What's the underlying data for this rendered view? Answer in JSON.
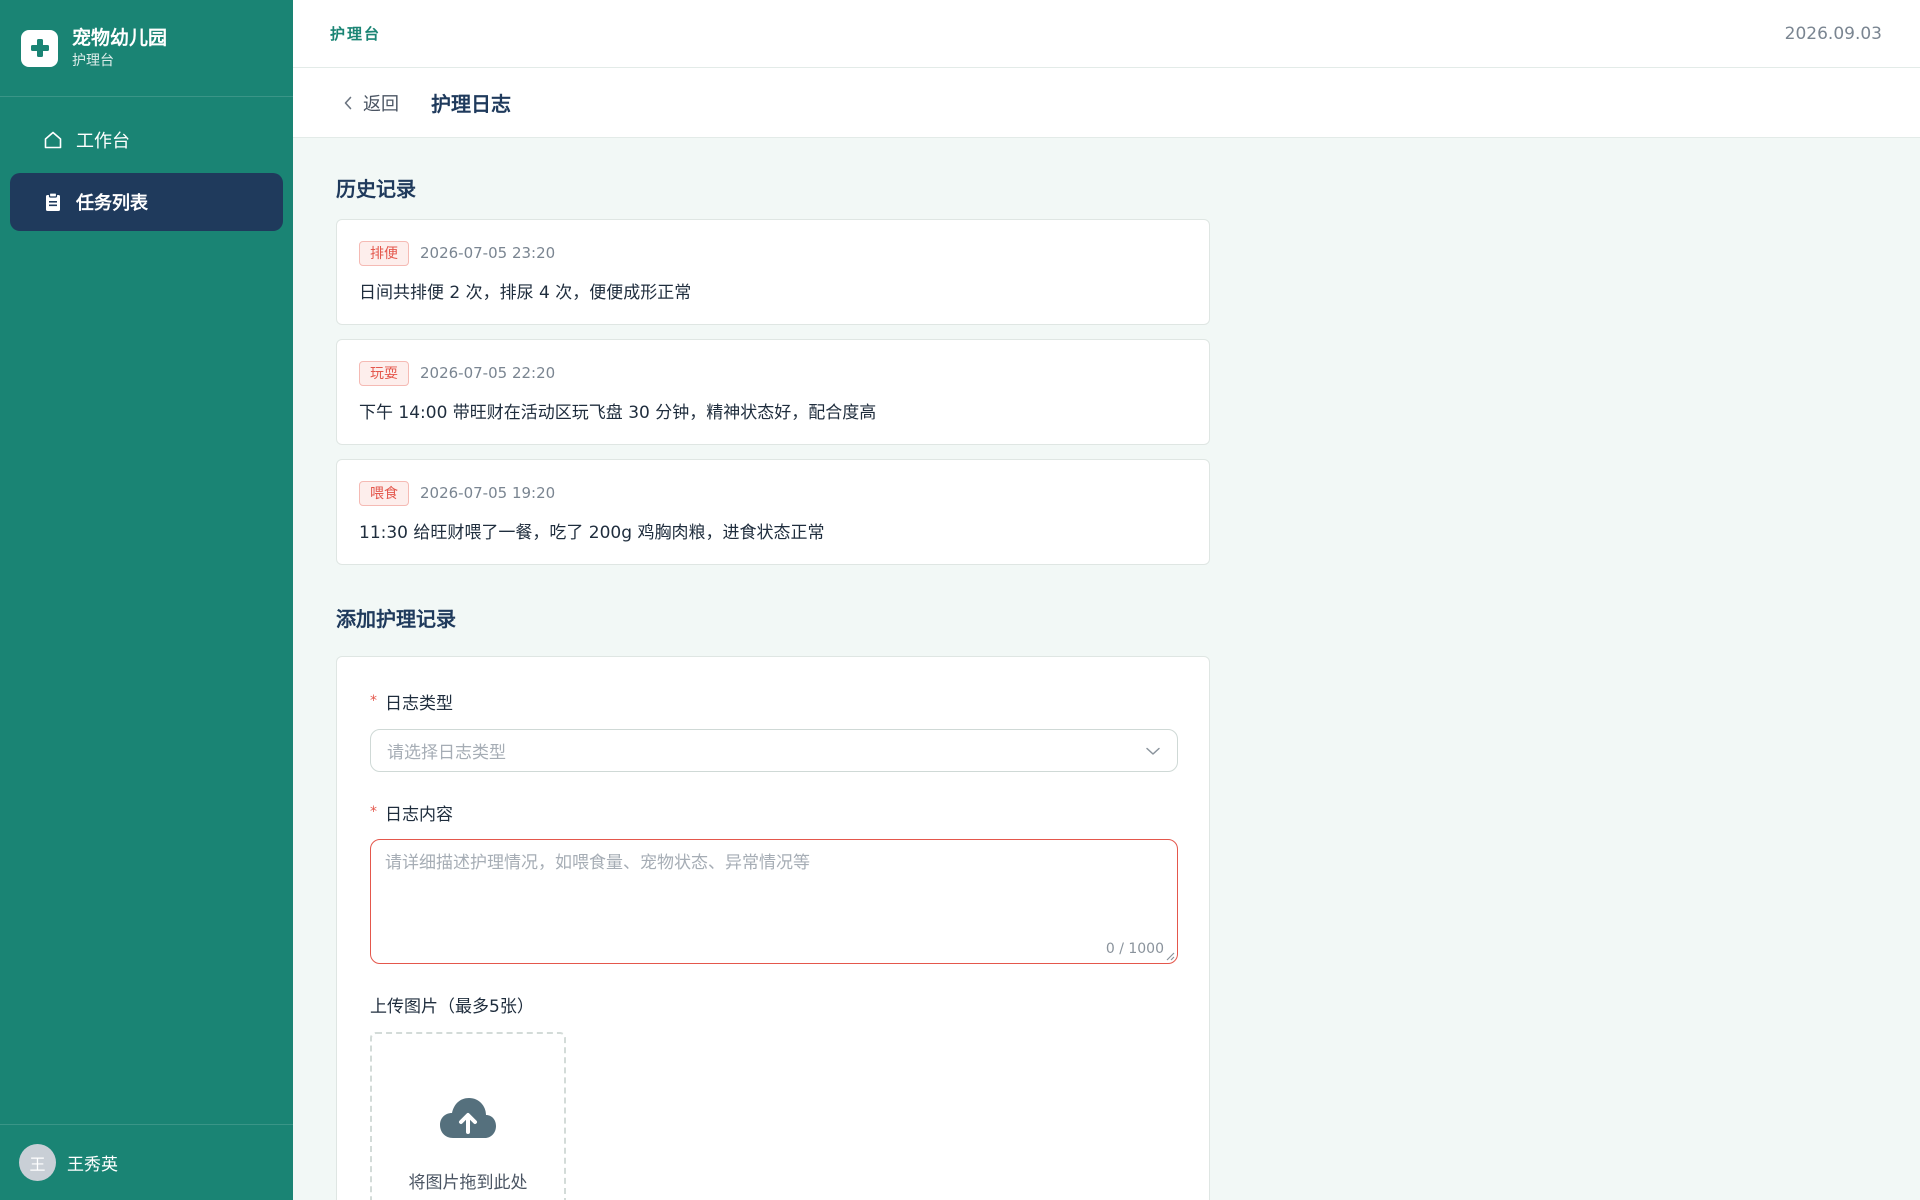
{
  "brand": {
    "title": "宠物幼儿园",
    "subtitle": "护理台"
  },
  "nav": [
    {
      "label": "工作台",
      "icon": "home-icon",
      "active": false
    },
    {
      "label": "任务列表",
      "icon": "clipboard-icon",
      "active": true
    }
  ],
  "user": {
    "avatar_letter": "王",
    "name": "王秀英"
  },
  "topbar": {
    "title": "护理台",
    "date": "2026.09.03"
  },
  "subheader": {
    "back_label": "返回",
    "page_title": "护理日志"
  },
  "history": {
    "title": "历史记录",
    "records": [
      {
        "tag": "排便",
        "time": "2026-07-05 23:20",
        "content": "日间共排便 2 次，排尿 4 次，便便成形正常"
      },
      {
        "tag": "玩耍",
        "time": "2026-07-05 22:20",
        "content": "下午 14:00 带旺财在活动区玩飞盘 30 分钟，精神状态好，配合度高"
      },
      {
        "tag": "喂食",
        "time": "2026-07-05 19:20",
        "content": "11:30 给旺财喂了一餐，吃了 200g 鸡胸肉粮，进食状态正常"
      }
    ]
  },
  "form": {
    "title": "添加护理记录",
    "type_label": "日志类型",
    "type_placeholder": "请选择日志类型",
    "content_label": "日志内容",
    "content_placeholder": "请详细描述护理情况，如喂食量、宠物状态、异常情况等",
    "content_counter": "0 / 1000",
    "upload_label": "上传图片（最多5张）",
    "upload_hint": "将图片拖到此处"
  },
  "colors": {
    "sidebar": "#1a8474",
    "active_nav": "#1f3a5c",
    "accent": "#1a8474",
    "tag_red": "#e4574c"
  }
}
